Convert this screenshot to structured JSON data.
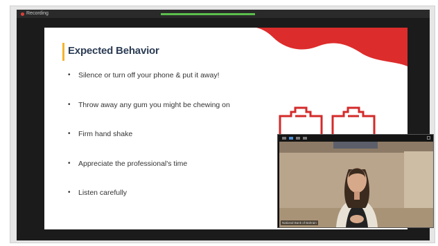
{
  "app": {
    "window_label": "Recording",
    "indicator_color": "#5bbf4b"
  },
  "slide": {
    "title": "Expected Behavior",
    "accent_color": "#f3b42b",
    "wave_color": "#dd2c2c",
    "bullets": [
      "Silence or turn off your phone & put it away!",
      "Throw away any gum you might be chewing on",
      "Firm hand shake",
      "Appreciate the professional's time",
      "Listen carefully"
    ],
    "icons": [
      "clipboard-icon",
      "clipboard-icon"
    ]
  },
  "video": {
    "caption": "National Bank of Bahrain"
  }
}
